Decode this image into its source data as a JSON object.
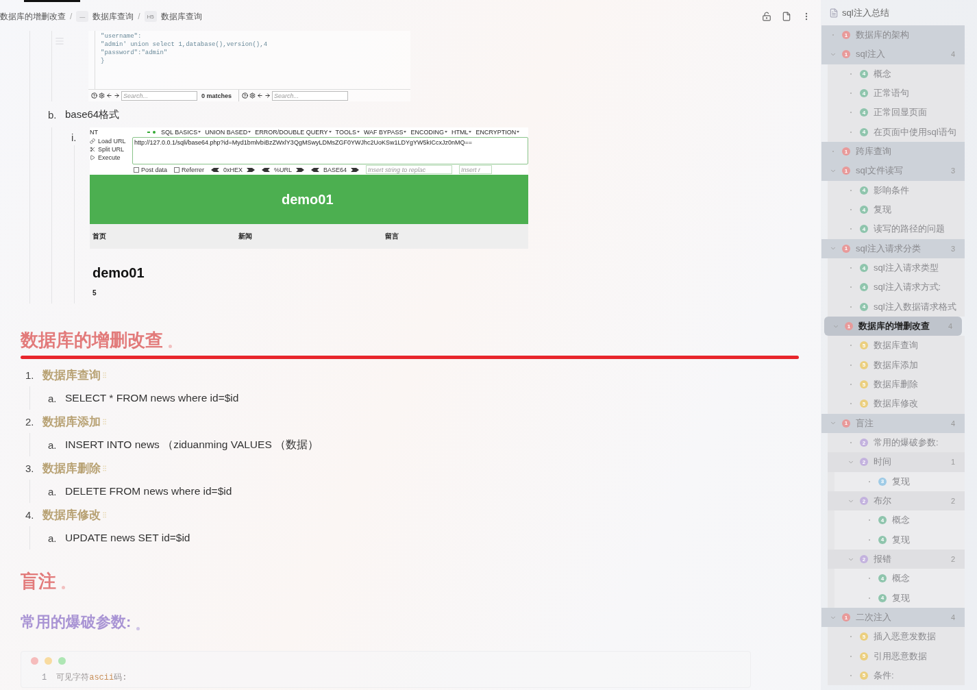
{
  "breadcrumb": [
    {
      "text": "数据库的增删改查"
    },
    {
      "separator": "/",
      "icon": "—",
      "text": "数据库查询"
    },
    {
      "separator": "/",
      "icon": "H5",
      "text": "数据库查询"
    }
  ],
  "json_viewer": {
    "lines": [
      "\"username\":",
      "\"admin' union select 1,database(),version(),4",
      "\"password\":\"admin\"",
      "}"
    ],
    "panes": [
      {
        "placeholder": "Search...",
        "matches": "0 matches"
      },
      {
        "placeholder": "Search..."
      }
    ]
  },
  "sub_item": {
    "marker": "b.",
    "text": "base64格式"
  },
  "hackbar": {
    "marker": "i.",
    "left_cut": "NT",
    "menus": [
      "SQL BASICS",
      "UNION BASED",
      "ERROR/DOUBLE QUERY",
      "TOOLS",
      "WAF BYPASS",
      "ENCODING",
      "HTML",
      "ENCRYPTION"
    ],
    "actions": [
      "Load URL",
      "Split URL",
      "Execute"
    ],
    "url": "http://127.0.0.1/sqli/base64.php?id=Myd1bmlvbiBzZWxlY3QgMSwyLDMsZGF0YWJhc2UoKSw1LDYgYW5kICcxJz0nMQ==",
    "options": [
      {
        "label": "Post data",
        "checked": false
      },
      {
        "label": "Referrer",
        "checked": false
      }
    ],
    "encoders": [
      "0xHEX",
      "%URL",
      "BASE64"
    ],
    "inputs": [
      {
        "placeholder": "Insert string to replac"
      },
      {
        "placeholder": "Insert r"
      }
    ],
    "site_title": "demo01",
    "nav": [
      "首页",
      "新闻",
      "留言"
    ],
    "page_heading": "demo01",
    "page_text": "5"
  },
  "section": {
    "title": "数据库的增删改查",
    "items": [
      {
        "number": "1.",
        "title": "数据库查询",
        "sub": [
          {
            "marker": "a.",
            "text": "SELECT * FROM news where id=$id"
          }
        ]
      },
      {
        "number": "2.",
        "title": "数据库添加",
        "sub": [
          {
            "marker": "a.",
            "text": "INSERT INTO news （ziduanming VALUES （数据）"
          }
        ]
      },
      {
        "number": "3.",
        "title": "数据库删除",
        "sub": [
          {
            "marker": "a.",
            "text": "DELETE FROM news where id=$id"
          }
        ]
      },
      {
        "number": "4.",
        "title": "数据库修改",
        "sub": [
          {
            "marker": "a.",
            "text": "UPDATE news SET id=$id"
          }
        ]
      }
    ]
  },
  "section2": {
    "title": "盲注"
  },
  "subheading": {
    "title": "常用的爆破参数:"
  },
  "code_block": {
    "lines": [
      {
        "number": "1",
        "parts": [
          {
            "kind": "plain",
            "text": "可见字符"
          },
          {
            "kind": "keyword",
            "text": "ascii"
          },
          {
            "kind": "plain",
            "text": "码:"
          }
        ]
      }
    ]
  },
  "outline": {
    "title": "sql注入总结",
    "items": [
      {
        "badge": "1",
        "color": "#e89a9a",
        "text": "数据库的架构",
        "selected": false
      },
      {
        "badge": "1",
        "color": "#e89a9a",
        "text": "sql注入",
        "count": "4",
        "expanded": true,
        "selected": false,
        "children": [
          {
            "badge": "4",
            "color": "#8fc5ad",
            "text": "概念",
            "selected": false
          },
          {
            "badge": "4",
            "color": "#8fc5ad",
            "text": "正常语句",
            "selected": false
          },
          {
            "badge": "4",
            "color": "#8fc5ad",
            "text": "正常回显页面",
            "selected": false
          },
          {
            "badge": "4",
            "color": "#8fc5ad",
            "text": "在页面中使用sql语句",
            "selected": false
          }
        ]
      },
      {
        "badge": "1",
        "color": "#e89a9a",
        "text": "跨库查询",
        "selected": false
      },
      {
        "badge": "1",
        "color": "#e89a9a",
        "text": "sql文件读写",
        "count": "3",
        "expanded": true,
        "selected": false,
        "children": [
          {
            "badge": "4",
            "color": "#8fc5ad",
            "text": "影响条件",
            "selected": false
          },
          {
            "badge": "4",
            "color": "#8fc5ad",
            "text": "复现",
            "selected": false
          },
          {
            "badge": "4",
            "color": "#8fc5ad",
            "text": "读写的路径的问题",
            "selected": false
          }
        ]
      },
      {
        "badge": "1",
        "color": "#e89a9a",
        "text": "sql注入请求分类",
        "count": "3",
        "expanded": true,
        "selected": false,
        "children": [
          {
            "badge": "4",
            "color": "#8fc5ad",
            "text": "sql注入请求类型",
            "selected": false
          },
          {
            "badge": "4",
            "color": "#8fc5ad",
            "text": "sql注入请求方式:",
            "selected": false
          },
          {
            "badge": "4",
            "color": "#8fc5ad",
            "text": "sql注入数据请求格式",
            "selected": false
          }
        ]
      },
      {
        "badge": "1",
        "color": "#e89a9a",
        "text": "数据库的增删改查",
        "count": "4",
        "expanded": true,
        "selected": true,
        "children": [
          {
            "badge": "5",
            "color": "#ebcf7f",
            "text": "数据库查询",
            "selected": false
          },
          {
            "badge": "5",
            "color": "#ebcf7f",
            "text": "数据库添加",
            "selected": false
          },
          {
            "badge": "5",
            "color": "#ebcf7f",
            "text": "数据库删除",
            "selected": false
          },
          {
            "badge": "5",
            "color": "#ebcf7f",
            "text": "数据库修改",
            "selected": false
          }
        ]
      },
      {
        "badge": "1",
        "color": "#e89a9a",
        "text": "盲注",
        "count": "4",
        "expanded": true,
        "selected": false,
        "children": [
          {
            "badge": "2",
            "color": "#c3b2de",
            "text": "常用的爆破参数:",
            "selected": false
          },
          {
            "badge": "2",
            "color": "#c3b2de",
            "text": "时间",
            "count": "1",
            "expanded": true,
            "selected": false,
            "children": [
              {
                "badge": "3",
                "color": "#9fcbe6",
                "text": "复现",
                "selected": false
              }
            ]
          },
          {
            "badge": "2",
            "color": "#c3b2de",
            "text": "布尔",
            "count": "2",
            "expanded": true,
            "selected": false,
            "children": [
              {
                "badge": "4",
                "color": "#8fc5ad",
                "text": "概念",
                "selected": false
              },
              {
                "badge": "4",
                "color": "#8fc5ad",
                "text": "复现",
                "selected": false
              }
            ]
          },
          {
            "badge": "2",
            "color": "#c3b2de",
            "text": "报错",
            "count": "2",
            "expanded": true,
            "selected": false,
            "children": [
              {
                "badge": "4",
                "color": "#8fc5ad",
                "text": "概念",
                "selected": false
              },
              {
                "badge": "4",
                "color": "#8fc5ad",
                "text": "复现",
                "selected": false
              }
            ]
          }
        ]
      },
      {
        "badge": "1",
        "color": "#e89a9a",
        "text": "二次注入",
        "count": "4",
        "expanded": true,
        "selected": false,
        "children": [
          {
            "badge": "5",
            "color": "#ebcf7f",
            "text": "插入恶意发数据",
            "selected": false
          },
          {
            "badge": "5",
            "color": "#ebcf7f",
            "text": "引用恶意数据",
            "selected": false
          },
          {
            "badge": "5",
            "color": "#ebcf7f",
            "text": "条件:",
            "selected": false
          }
        ]
      }
    ]
  }
}
